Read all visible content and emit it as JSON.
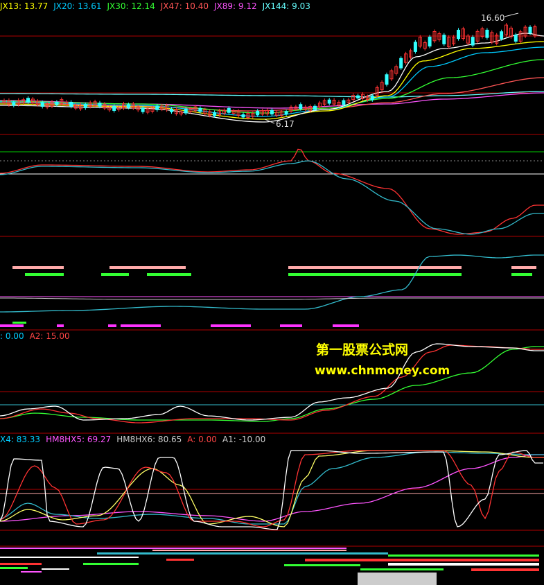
{
  "panel1": {
    "indicators": [
      {
        "label": "JX13: 13.77",
        "color": "#ffff00"
      },
      {
        "label": "JX20: 13.61",
        "color": "#00ccff"
      },
      {
        "label": "JX30: 12.14",
        "color": "#33ff33"
      },
      {
        "label": "JX47: 10.40",
        "color": "#ff5555"
      },
      {
        "label": "JX89: 9.12",
        "color": "#ff55ff"
      },
      {
        "label": "JX144: 9.03",
        "color": "#66ffff"
      }
    ],
    "high_label": "16.60",
    "low_label": "6.17"
  },
  "panel4": {
    "indicators": [
      {
        "label": ": 0.00",
        "color": "#00ccff"
      },
      {
        "label": "A2: 15.00",
        "color": "#ff4444"
      }
    ]
  },
  "panel5": {
    "indicators": [
      {
        "label": "X4: 83.33",
        "color": "#00ccff"
      },
      {
        "label": "HM8HX5: 69.27",
        "color": "#ff55ff"
      },
      {
        "label": "HM8HX6: 80.65",
        "color": "#cccccc"
      },
      {
        "label": "A: 0.00",
        "color": "#ff4444"
      },
      {
        "label": "A1: -10.00",
        "color": "#cccccc"
      }
    ]
  },
  "watermark": {
    "title": "第一股票公式网",
    "url": "www.chnmoney.com"
  },
  "colors": {
    "background": "#000000",
    "separator": "#b00000",
    "up_candle": "#ff3333",
    "down_candle": "#33ffff",
    "watermark": "#ffff00"
  }
}
